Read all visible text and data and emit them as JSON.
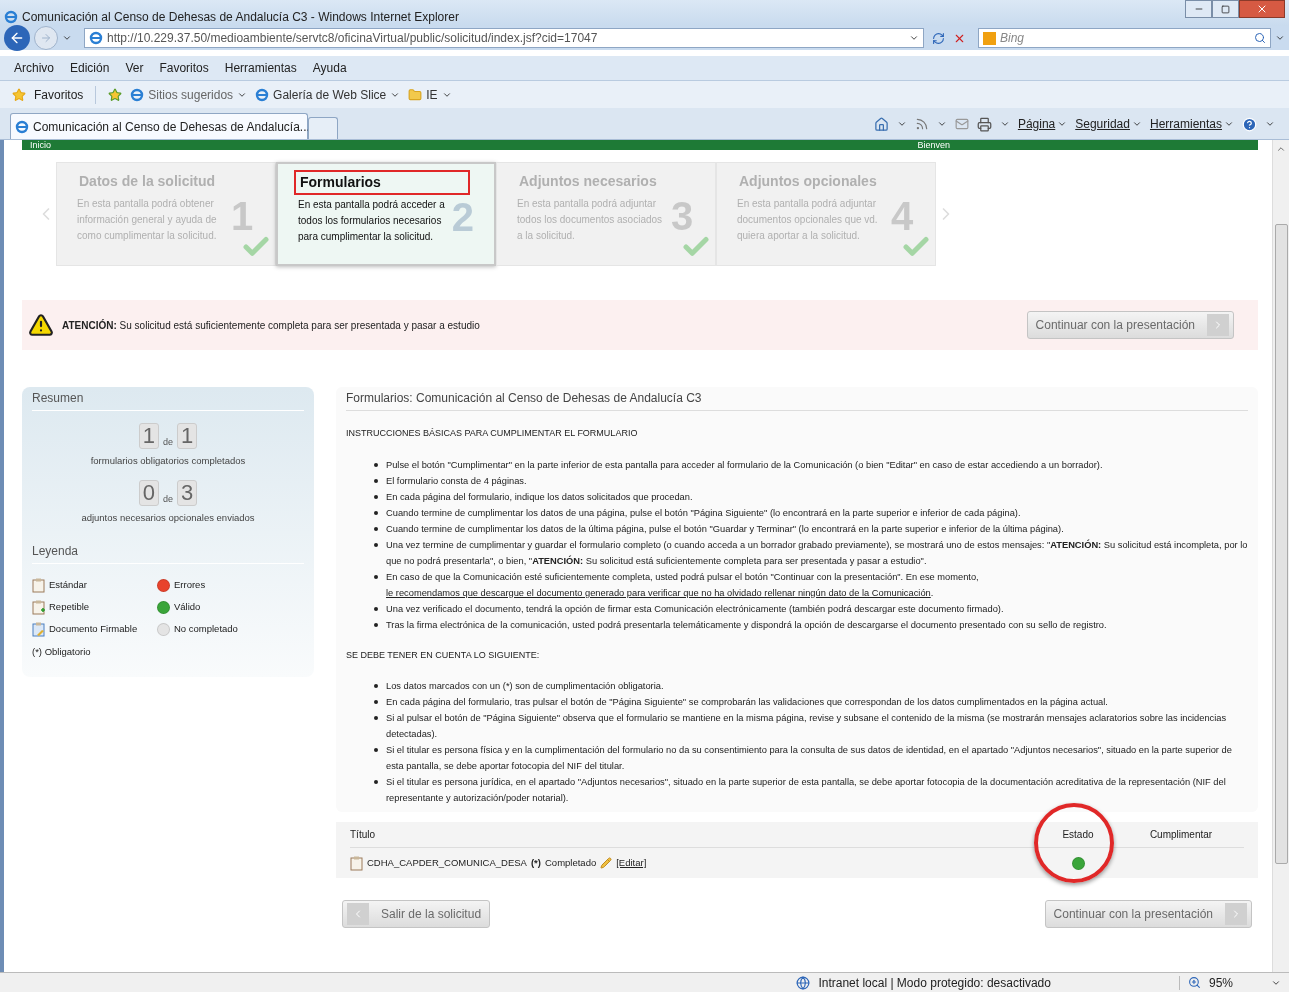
{
  "window": {
    "title": "Comunicación al Censo de Dehesas de Andalucía C3 - Windows Internet Explorer"
  },
  "address_bar": {
    "url": "http://10.229.37.50/medioambiente/servtc8/oficinaVirtual/public/solicitud/index.jsf?cid=17047",
    "search_placeholder": "Bing"
  },
  "menu": [
    "Archivo",
    "Edición",
    "Ver",
    "Favoritos",
    "Herramientas",
    "Ayuda"
  ],
  "favorites_bar": {
    "label": "Favoritos",
    "items": [
      "Sitios sugeridos",
      "Galería de Web Slice",
      "IE"
    ]
  },
  "tabs": [
    {
      "label": "Comunicación al Censo de Dehesas de Andalucía...",
      "selected": true
    }
  ],
  "command_bar": [
    "Página",
    "Seguridad",
    "Herramientas"
  ],
  "top_nav": {
    "left": "Inicio",
    "right": "Bienven"
  },
  "steps": [
    {
      "title": "Datos de la solicitud",
      "description": "En esta pantalla podrá obtener información general y ayuda de como cumplimentar la solicitud.",
      "number": "1",
      "selected": false,
      "highlighted": false
    },
    {
      "title": "Formularios",
      "description": "En esta pantalla podrá acceder a todos los formularios necesarios para cumplimentar la solicitud.",
      "number": "2",
      "selected": true,
      "highlighted": true
    },
    {
      "title": "Adjuntos necesarios",
      "description": "En esta pantalla podrá adjuntar todos los documentos asociados a la solicitud.",
      "number": "3",
      "selected": false,
      "highlighted": false
    },
    {
      "title": "Adjuntos opcionales",
      "description": "En esta pantalla podrá adjuntar documentos opcionales que vd. quiera aportar a la solicitud.",
      "number": "4",
      "selected": false,
      "highlighted": false
    }
  ],
  "alert": {
    "text": "**ATENCIÓN:** Su solicitud está suficientemente completa para ser presentada y pasar a estudio",
    "button": "Continuar con la presentación"
  },
  "summary": {
    "title": "Resumen",
    "counters": [
      {
        "done": "1",
        "of": "de",
        "total": "1",
        "caption": "formularios obligatorios completados"
      },
      {
        "done": "0",
        "of": "de",
        "total": "3",
        "caption": "adjuntos necesarios opcionales enviados"
      }
    ],
    "legend_title": "Leyenda",
    "legend": [
      {
        "kind": "standard",
        "label": "Estándar"
      },
      {
        "kind": "dot",
        "label": "Errores",
        "color": "#e8432c"
      },
      {
        "kind": "repeatable",
        "label": "Repetible"
      },
      {
        "kind": "dot",
        "label": "Válido",
        "color": "#3aa53a"
      },
      {
        "kind": "signable",
        "label": "Documento Firmable"
      },
      {
        "kind": "dot",
        "label": "No completado",
        "color": "#e4e4e4"
      }
    ],
    "note": "(*) Obligatorio"
  },
  "content": {
    "title": "Formularios: Comunicación al Censo de Dehesas de Andalucía C3",
    "sections": [
      {
        "heading": "INSTRUCCIONES BÁSICAS PARA CUMPLIMENTAR EL FORMULARIO",
        "items": [
          {
            "text": "Pulse el botón \"Cumplimentar\" en la parte inferior de esta pantalla para acceder al formulario de la Comunicación (o bien \"Editar\" en caso de estar accediendo a un borrador)."
          },
          {
            "text": "El formulario consta de 4 páginas."
          },
          {
            "text": "En cada página del formulario, indique los datos solicitados que procedan."
          },
          {
            "text": "Cuando termine de cumplimentar los datos de una página, pulse el botón \"Página Siguiente\" (lo encontrará en la parte superior e inferior de cada página)."
          },
          {
            "text": "Cuando termine de cumplimentar los datos de la última página, pulse el botón \"Guardar y Terminar\" (lo encontrará en la parte superior e inferior de la última página)."
          },
          {
            "text": "Una vez termine de cumplimentar y guardar el formulario completo (o cuando acceda a un borrador grabado previamente), se mostrará uno de estos mensajes: \"**ATENCIÓN:** Su solicitud está incompleta, por lo que no podrá presentarla\", o bien, \"**ATENCIÓN:** Su solicitud está suficientemente completa para ser presentada y pasar a estudio\"."
          },
          {
            "text": "En caso de que la Comunicación esté suficientemente completa, usted podrá pulsar el botón \"Continuar con la presentación\". En ese momento,",
            "link": "le recomendamos que descargue el documento generado para verificar que no ha olvidado rellenar ningún dato de la Comunicación",
            "tail": "."
          },
          {
            "text": "Una vez verificado el documento, tendrá la opción de firmar esta Comunicación electrónicamente (también podrá descargar este documento firmado)."
          },
          {
            "text": "Tras la firma electrónica de la comunicación, usted podrá presentarla telemáticamente y dispondrá la opción de descargarse el documento presentado con su sello de registro."
          }
        ]
      },
      {
        "heading": "SE DEBE TENER EN CUENTA LO SIGUIENTE:",
        "items": [
          {
            "text": "Los datos marcados con un (*) son de cumplimentación obligatoria."
          },
          {
            "text": "En cada página del formulario, tras pulsar el botón de \"Página Siguiente\" se comprobarán las validaciones que correspondan de los datos cumplimentados en la página actual."
          },
          {
            "text": "Si al pulsar el botón de \"Página Siguiente\" observa que el formulario se mantiene en la misma página, revise y subsane el contenido de la misma (se mostrarán mensajes aclaratorios sobre las incidencias detectadas)."
          },
          {
            "text": "Si el titular es persona física y en la cumplimentación del formulario no da su consentimiento para la consulta de sus datos de identidad, en el apartado \"Adjuntos necesarios\", situado en la parte superior de esta pantalla, se debe aportar fotocopia del NIF del titular."
          },
          {
            "text": "Si el titular es persona jurídica, en el apartado \"Adjuntos necesarios\", situado en la parte superior de esta pantalla, se debe aportar fotocopia de la documentación acreditativa de la representación (NIF del representante y autorización/poder notarial)."
          }
        ]
      }
    ],
    "table": {
      "columns": [
        {
          "label": "Título",
          "circled": false
        },
        {
          "label": "Estado",
          "circled": true
        },
        {
          "label": "Cumplimentar",
          "circled": false
        }
      ],
      "rows": [
        {
          "name": "CDHA_CAPDER_COMUNICA_DESA",
          "required": "(*)",
          "status_text": "Completado",
          "edit": "[Editar]",
          "color": "#3aa53a"
        }
      ]
    }
  },
  "buttons": {
    "back": "Salir de la solicitud",
    "continue": "Continuar con la presentación"
  },
  "status_bar": {
    "zone": "Intranet local | Modo protegido: desactivado",
    "zoom": "95%"
  }
}
